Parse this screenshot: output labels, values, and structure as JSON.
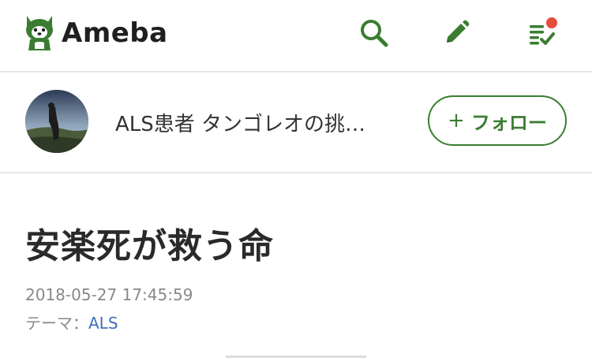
{
  "header": {
    "logo_text": "Ameba",
    "icons": {
      "logo": "ameba-mascot-icon",
      "search": "search-icon",
      "edit": "pencil-icon",
      "feed": "checklist-icon"
    },
    "notification_dot_color": "#e74c3c",
    "brand_color": "#3a7d31"
  },
  "blog": {
    "title": "ALS患者 タンゴレオの挑…",
    "follow_label": "フォロー",
    "follow_plus": "+"
  },
  "article": {
    "title": "安楽死が救う命",
    "date": "2018-05-27 17:45:59",
    "theme_label": "テーマ：",
    "theme_value": "ALS",
    "link_color": "#3b6fb6"
  }
}
